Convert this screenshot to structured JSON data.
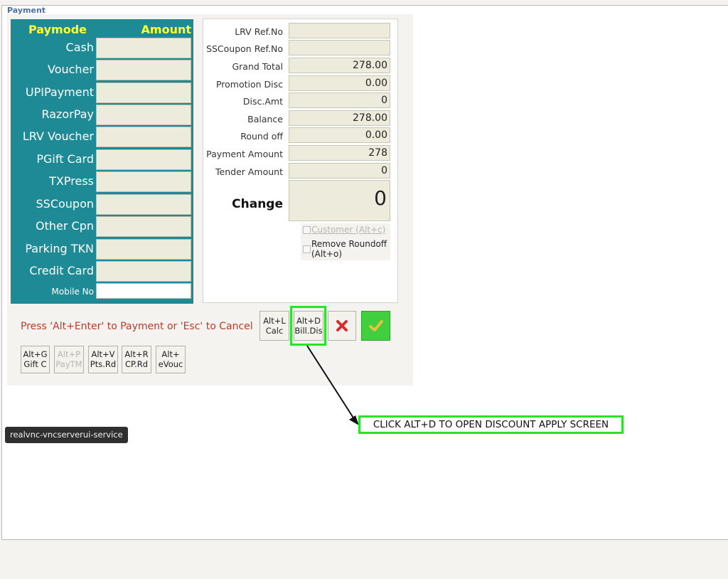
{
  "window": {
    "legend": "Payment"
  },
  "paymodes": {
    "header_paymode": "Paymode",
    "header_amount": "Amount",
    "rows": [
      {
        "label": "Cash",
        "value": ""
      },
      {
        "label": "Voucher",
        "value": ""
      },
      {
        "label": "UPIPayment",
        "value": ""
      },
      {
        "label": "RazorPay",
        "value": ""
      },
      {
        "label": "LRV Voucher",
        "value": ""
      },
      {
        "label": "PGift Card",
        "value": ""
      },
      {
        "label": "TXPress",
        "value": ""
      },
      {
        "label": "SSCoupon",
        "value": ""
      },
      {
        "label": "Other Cpn",
        "value": ""
      },
      {
        "label": "Parking TKN",
        "value": ""
      },
      {
        "label": "Credit Card",
        "value": ""
      }
    ],
    "mobile_label": "Mobile No",
    "mobile_value": ""
  },
  "summary": {
    "fields": [
      {
        "label": "LRV Ref.No",
        "value": ""
      },
      {
        "label": "SSCoupon Ref.No",
        "value": ""
      },
      {
        "label": "Grand Total",
        "value": "278.00"
      },
      {
        "label": "Promotion Disc",
        "value": "0.00"
      },
      {
        "label": "Disc.Amt",
        "value": "0"
      },
      {
        "label": "Balance",
        "value": "278.00"
      },
      {
        "label": "Round off",
        "value": "0.00"
      },
      {
        "label": "Payment Amount",
        "value": "278"
      },
      {
        "label": "Tender Amount",
        "value": "0"
      }
    ],
    "change_label": "Change",
    "change_value": "0",
    "customer_checkbox": "Customer (Alt+c)",
    "roundoff_checkbox_line1": "Remove Roundoff",
    "roundoff_checkbox_line2": "(Alt+o)"
  },
  "actions": {
    "instruction": "Press 'Alt+Enter' to Payment or 'Esc' to Cancel",
    "calc": {
      "l1": "Alt+L",
      "l2": "Calc"
    },
    "bill_dis": {
      "l1": "Alt+D",
      "l2": "Bill.Dis"
    },
    "shortcuts": [
      {
        "l1": "Alt+G",
        "l2": "Gift C",
        "enabled": true
      },
      {
        "l1": "Alt+P",
        "l2": "PayTM",
        "enabled": false
      },
      {
        "l1": "Alt+V",
        "l2": "Pts.Rd",
        "enabled": true
      },
      {
        "l1": "Alt+R",
        "l2": "CP.Rd",
        "enabled": true
      },
      {
        "l1": "Alt+",
        "l2": "eVouc",
        "enabled": true
      }
    ]
  },
  "tooltip": "realvnc-vncserverui-service",
  "callout": "CLICK ALT+D TO OPEN DISCOUNT APPLY SCREEN",
  "colors": {
    "panel_teal": "#1e8a96",
    "header_yellow": "#ffff33",
    "instruction_red": "#c0392b",
    "highlight_green": "#2ee02e"
  }
}
